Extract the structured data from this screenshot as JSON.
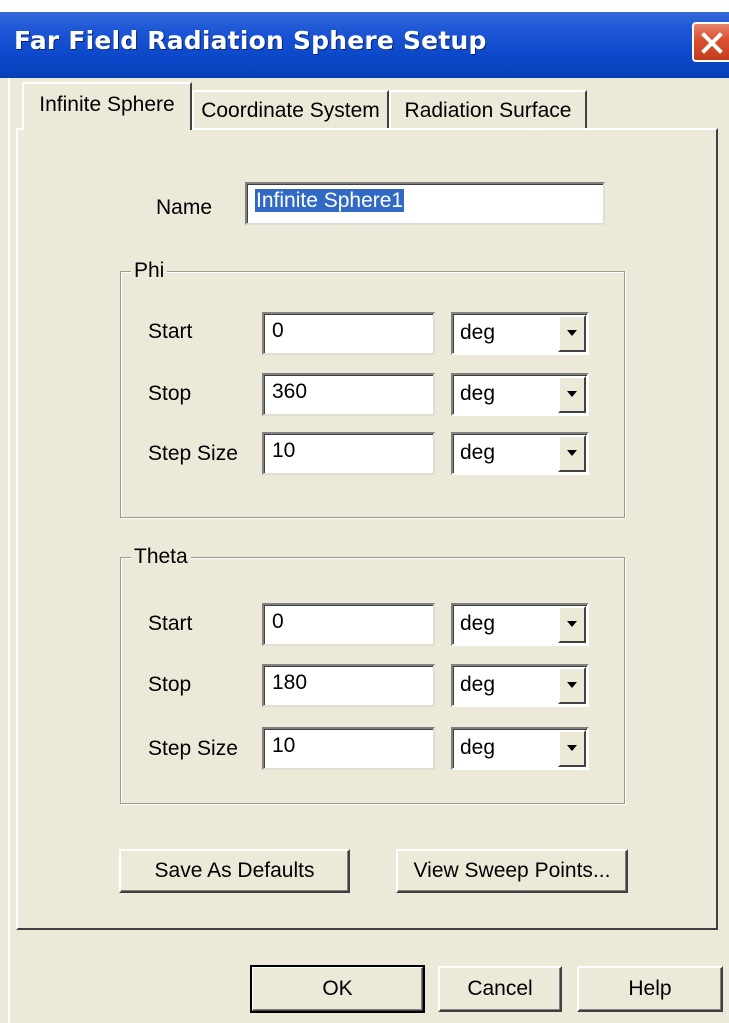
{
  "window": {
    "title": "Far Field Radiation Sphere Setup"
  },
  "tabs": [
    {
      "label": "Infinite Sphere",
      "active": true
    },
    {
      "label": "Coordinate System",
      "active": false
    },
    {
      "label": "Radiation Surface",
      "active": false
    }
  ],
  "name_field": {
    "label": "Name",
    "value": "Infinite Sphere1"
  },
  "phi": {
    "title": "Phi",
    "rows": [
      {
        "label": "Start",
        "value": "0",
        "unit": "deg"
      },
      {
        "label": "Stop",
        "value": "360",
        "unit": "deg"
      },
      {
        "label": "Step Size",
        "value": "10",
        "unit": "deg"
      }
    ]
  },
  "theta": {
    "title": "Theta",
    "rows": [
      {
        "label": "Start",
        "value": "0",
        "unit": "deg"
      },
      {
        "label": "Stop",
        "value": "180",
        "unit": "deg"
      },
      {
        "label": "Step Size",
        "value": "10",
        "unit": "deg"
      }
    ]
  },
  "panel_buttons": {
    "save_defaults": "Save As Defaults",
    "view_sweep": "View Sweep Points..."
  },
  "dialog_buttons": {
    "ok": "OK",
    "cancel": "Cancel",
    "help": "Help"
  },
  "colors": {
    "title_bar": "#0a47c8",
    "close_button": "#d8502f",
    "face": "#ece9d8",
    "selection": "#316ac5"
  },
  "icons": {
    "close": "close-icon",
    "dropdown": "chevron-down-icon"
  }
}
